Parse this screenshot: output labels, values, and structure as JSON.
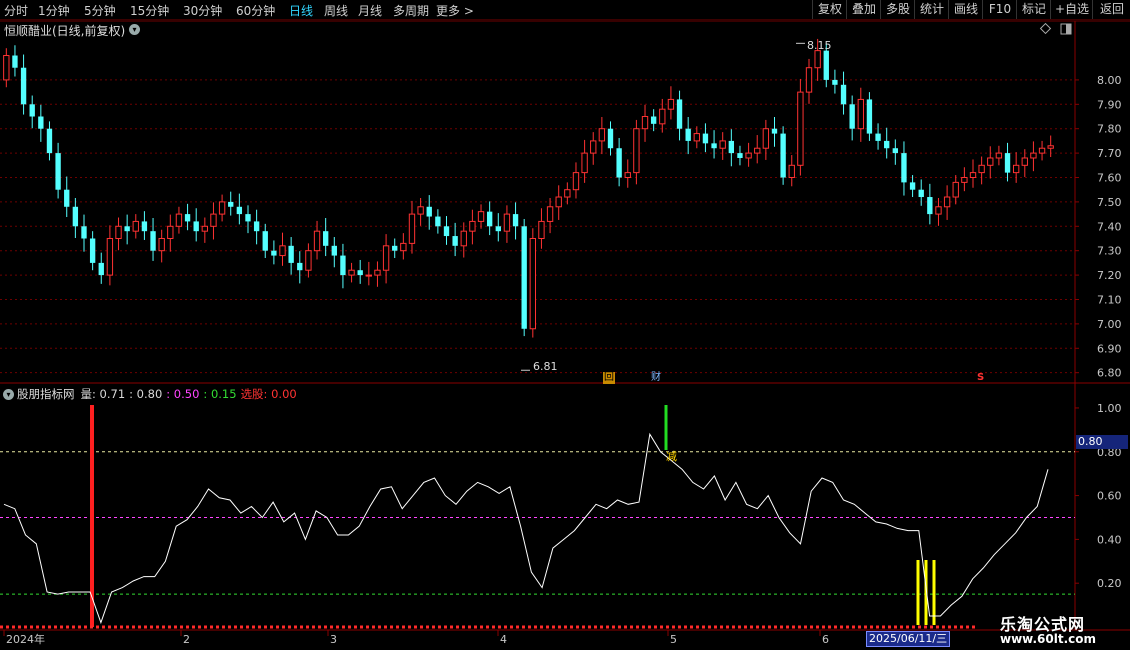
{
  "toolbar": {
    "periods": [
      "分时",
      "1分钟",
      "5分钟",
      "15分钟",
      "30分钟",
      "60分钟",
      "日线",
      "周线",
      "月线",
      "多周期",
      "更多 >"
    ],
    "active_period": "日线",
    "actions": [
      "复权",
      "叠加",
      "多股",
      "统计",
      "画线",
      "F10",
      "标记",
      "+自选",
      "返回"
    ]
  },
  "stock_title": "恒顺醋业(日线,前复权)",
  "price_axis": {
    "labels": [
      "8.00",
      "7.90",
      "7.80",
      "7.70",
      "7.60",
      "7.50",
      "7.40",
      "7.30",
      "7.20",
      "7.10",
      "7.00",
      "6.90",
      "6.80"
    ]
  },
  "annotations": {
    "high": "8.15",
    "low": "6.81",
    "marker_hui": "回",
    "marker_cai": "财",
    "marker_s": "S",
    "ind_marker": "减"
  },
  "indicator": {
    "name": "股朋指标网",
    "items": [
      {
        "text": "量: 0.71",
        "color": "#d8d8d8"
      },
      {
        "text": ": 0.80",
        "color": "#d8d8d8"
      },
      {
        "text": ": 0.50",
        "color": "#ff44ff"
      },
      {
        "text": ": 0.15",
        "color": "#33dd33"
      },
      {
        "text": "选股: 0.00",
        "color": "#ff3333"
      }
    ],
    "axis_labels": [
      "1.00",
      "0.80",
      "0.60",
      "0.40",
      "0.20"
    ],
    "current_value": "0.80"
  },
  "time_axis": {
    "labels": [
      "2024年",
      "2",
      "3",
      "4",
      "5",
      "6"
    ],
    "cursor_date": "2025/06/11/三"
  },
  "watermark": {
    "line1": "乐淘公式网",
    "line2": "www.60lt.com"
  },
  "colors": {
    "up": "#ff3232",
    "down": "#54ffff",
    "grid": "#6e0000",
    "background": "#000000"
  },
  "chart_data": {
    "type": "candlestick",
    "series_daily": {
      "open": [
        8.0,
        8.1,
        8.05,
        7.9,
        7.85,
        7.8,
        7.7,
        7.55,
        7.48,
        7.4,
        7.35,
        7.25,
        7.2,
        7.35,
        7.4,
        7.38,
        7.42,
        7.38,
        7.3,
        7.35,
        7.4,
        7.45,
        7.42,
        7.38,
        7.4,
        7.45,
        7.5,
        7.48,
        7.45,
        7.42,
        7.38,
        7.3,
        7.28,
        7.32,
        7.25,
        7.22,
        7.3,
        7.38,
        7.32,
        7.28,
        7.2,
        7.22,
        7.2,
        7.2,
        7.22,
        7.32,
        7.3,
        7.33,
        7.45,
        7.48,
        7.44,
        7.4,
        7.36,
        7.32,
        7.38,
        7.42,
        7.46,
        7.4,
        7.38,
        7.45,
        7.4,
        6.98,
        7.35,
        7.42,
        7.48,
        7.52,
        7.55,
        7.62,
        7.7,
        7.75,
        7.8,
        7.72,
        7.6,
        7.62,
        7.8,
        7.85,
        7.82,
        7.88,
        7.92,
        7.8,
        7.75,
        7.78,
        7.74,
        7.72,
        7.75,
        7.7,
        7.68,
        7.7,
        7.72,
        7.8,
        7.78,
        7.6,
        7.65,
        7.95,
        8.05,
        8.12,
        8.0,
        7.98,
        7.9,
        7.8,
        7.92,
        7.78,
        7.75,
        7.72,
        7.7,
        7.58,
        7.55,
        7.52,
        7.45,
        7.48,
        7.52,
        7.58,
        7.6,
        7.62,
        7.65,
        7.68,
        7.7,
        7.62,
        7.65,
        7.68,
        7.7,
        7.72
      ],
      "close": [
        8.1,
        8.05,
        7.9,
        7.85,
        7.8,
        7.7,
        7.55,
        7.48,
        7.4,
        7.35,
        7.25,
        7.2,
        7.35,
        7.4,
        7.38,
        7.42,
        7.38,
        7.3,
        7.35,
        7.4,
        7.45,
        7.42,
        7.38,
        7.4,
        7.45,
        7.5,
        7.48,
        7.45,
        7.42,
        7.38,
        7.3,
        7.28,
        7.32,
        7.25,
        7.22,
        7.3,
        7.38,
        7.32,
        7.28,
        7.2,
        7.22,
        7.2,
        7.2,
        7.22,
        7.32,
        7.3,
        7.33,
        7.45,
        7.48,
        7.44,
        7.4,
        7.36,
        7.32,
        7.38,
        7.42,
        7.46,
        7.4,
        7.38,
        7.45,
        7.4,
        6.98,
        7.35,
        7.42,
        7.48,
        7.52,
        7.55,
        7.62,
        7.7,
        7.75,
        7.8,
        7.72,
        7.6,
        7.62,
        7.8,
        7.85,
        7.82,
        7.88,
        7.92,
        7.8,
        7.75,
        7.78,
        7.74,
        7.72,
        7.75,
        7.7,
        7.68,
        7.7,
        7.72,
        7.8,
        7.78,
        7.6,
        7.65,
        7.95,
        8.05,
        8.12,
        8.0,
        7.98,
        7.9,
        7.8,
        7.92,
        7.78,
        7.75,
        7.72,
        7.7,
        7.58,
        7.55,
        7.52,
        7.45,
        7.48,
        7.52,
        7.58,
        7.6,
        7.62,
        7.65,
        7.68,
        7.7,
        7.62,
        7.65,
        7.68,
        7.7,
        7.72,
        7.73
      ],
      "y_range": [
        6.77,
        8.18
      ]
    },
    "series_indicator": {
      "values": [
        0.56,
        0.54,
        0.42,
        0.38,
        0.16,
        0.15,
        0.16,
        0.16,
        0.16,
        0.02,
        0.16,
        0.18,
        0.21,
        0.23,
        0.23,
        0.3,
        0.46,
        0.49,
        0.55,
        0.63,
        0.59,
        0.58,
        0.52,
        0.55,
        0.5,
        0.57,
        0.48,
        0.52,
        0.4,
        0.53,
        0.5,
        0.42,
        0.42,
        0.46,
        0.55,
        0.63,
        0.64,
        0.54,
        0.6,
        0.66,
        0.68,
        0.6,
        0.56,
        0.62,
        0.66,
        0.64,
        0.61,
        0.64,
        0.46,
        0.25,
        0.18,
        0.36,
        0.4,
        0.44,
        0.5,
        0.56,
        0.54,
        0.58,
        0.56,
        0.57,
        0.88,
        0.8,
        0.76,
        0.72,
        0.66,
        0.63,
        0.69,
        0.58,
        0.66,
        0.56,
        0.54,
        0.6,
        0.5,
        0.43,
        0.38,
        0.62,
        0.68,
        0.66,
        0.58,
        0.56,
        0.52,
        0.48,
        0.47,
        0.45,
        0.44,
        0.44,
        0.05,
        0.05,
        0.1,
        0.14,
        0.22,
        0.27,
        0.33,
        0.38,
        0.43,
        0.5,
        0.55,
        0.72
      ],
      "y_range": [
        0.0,
        1.05
      ],
      "reference_lines": [
        0.8,
        0.5,
        0.15
      ]
    }
  }
}
